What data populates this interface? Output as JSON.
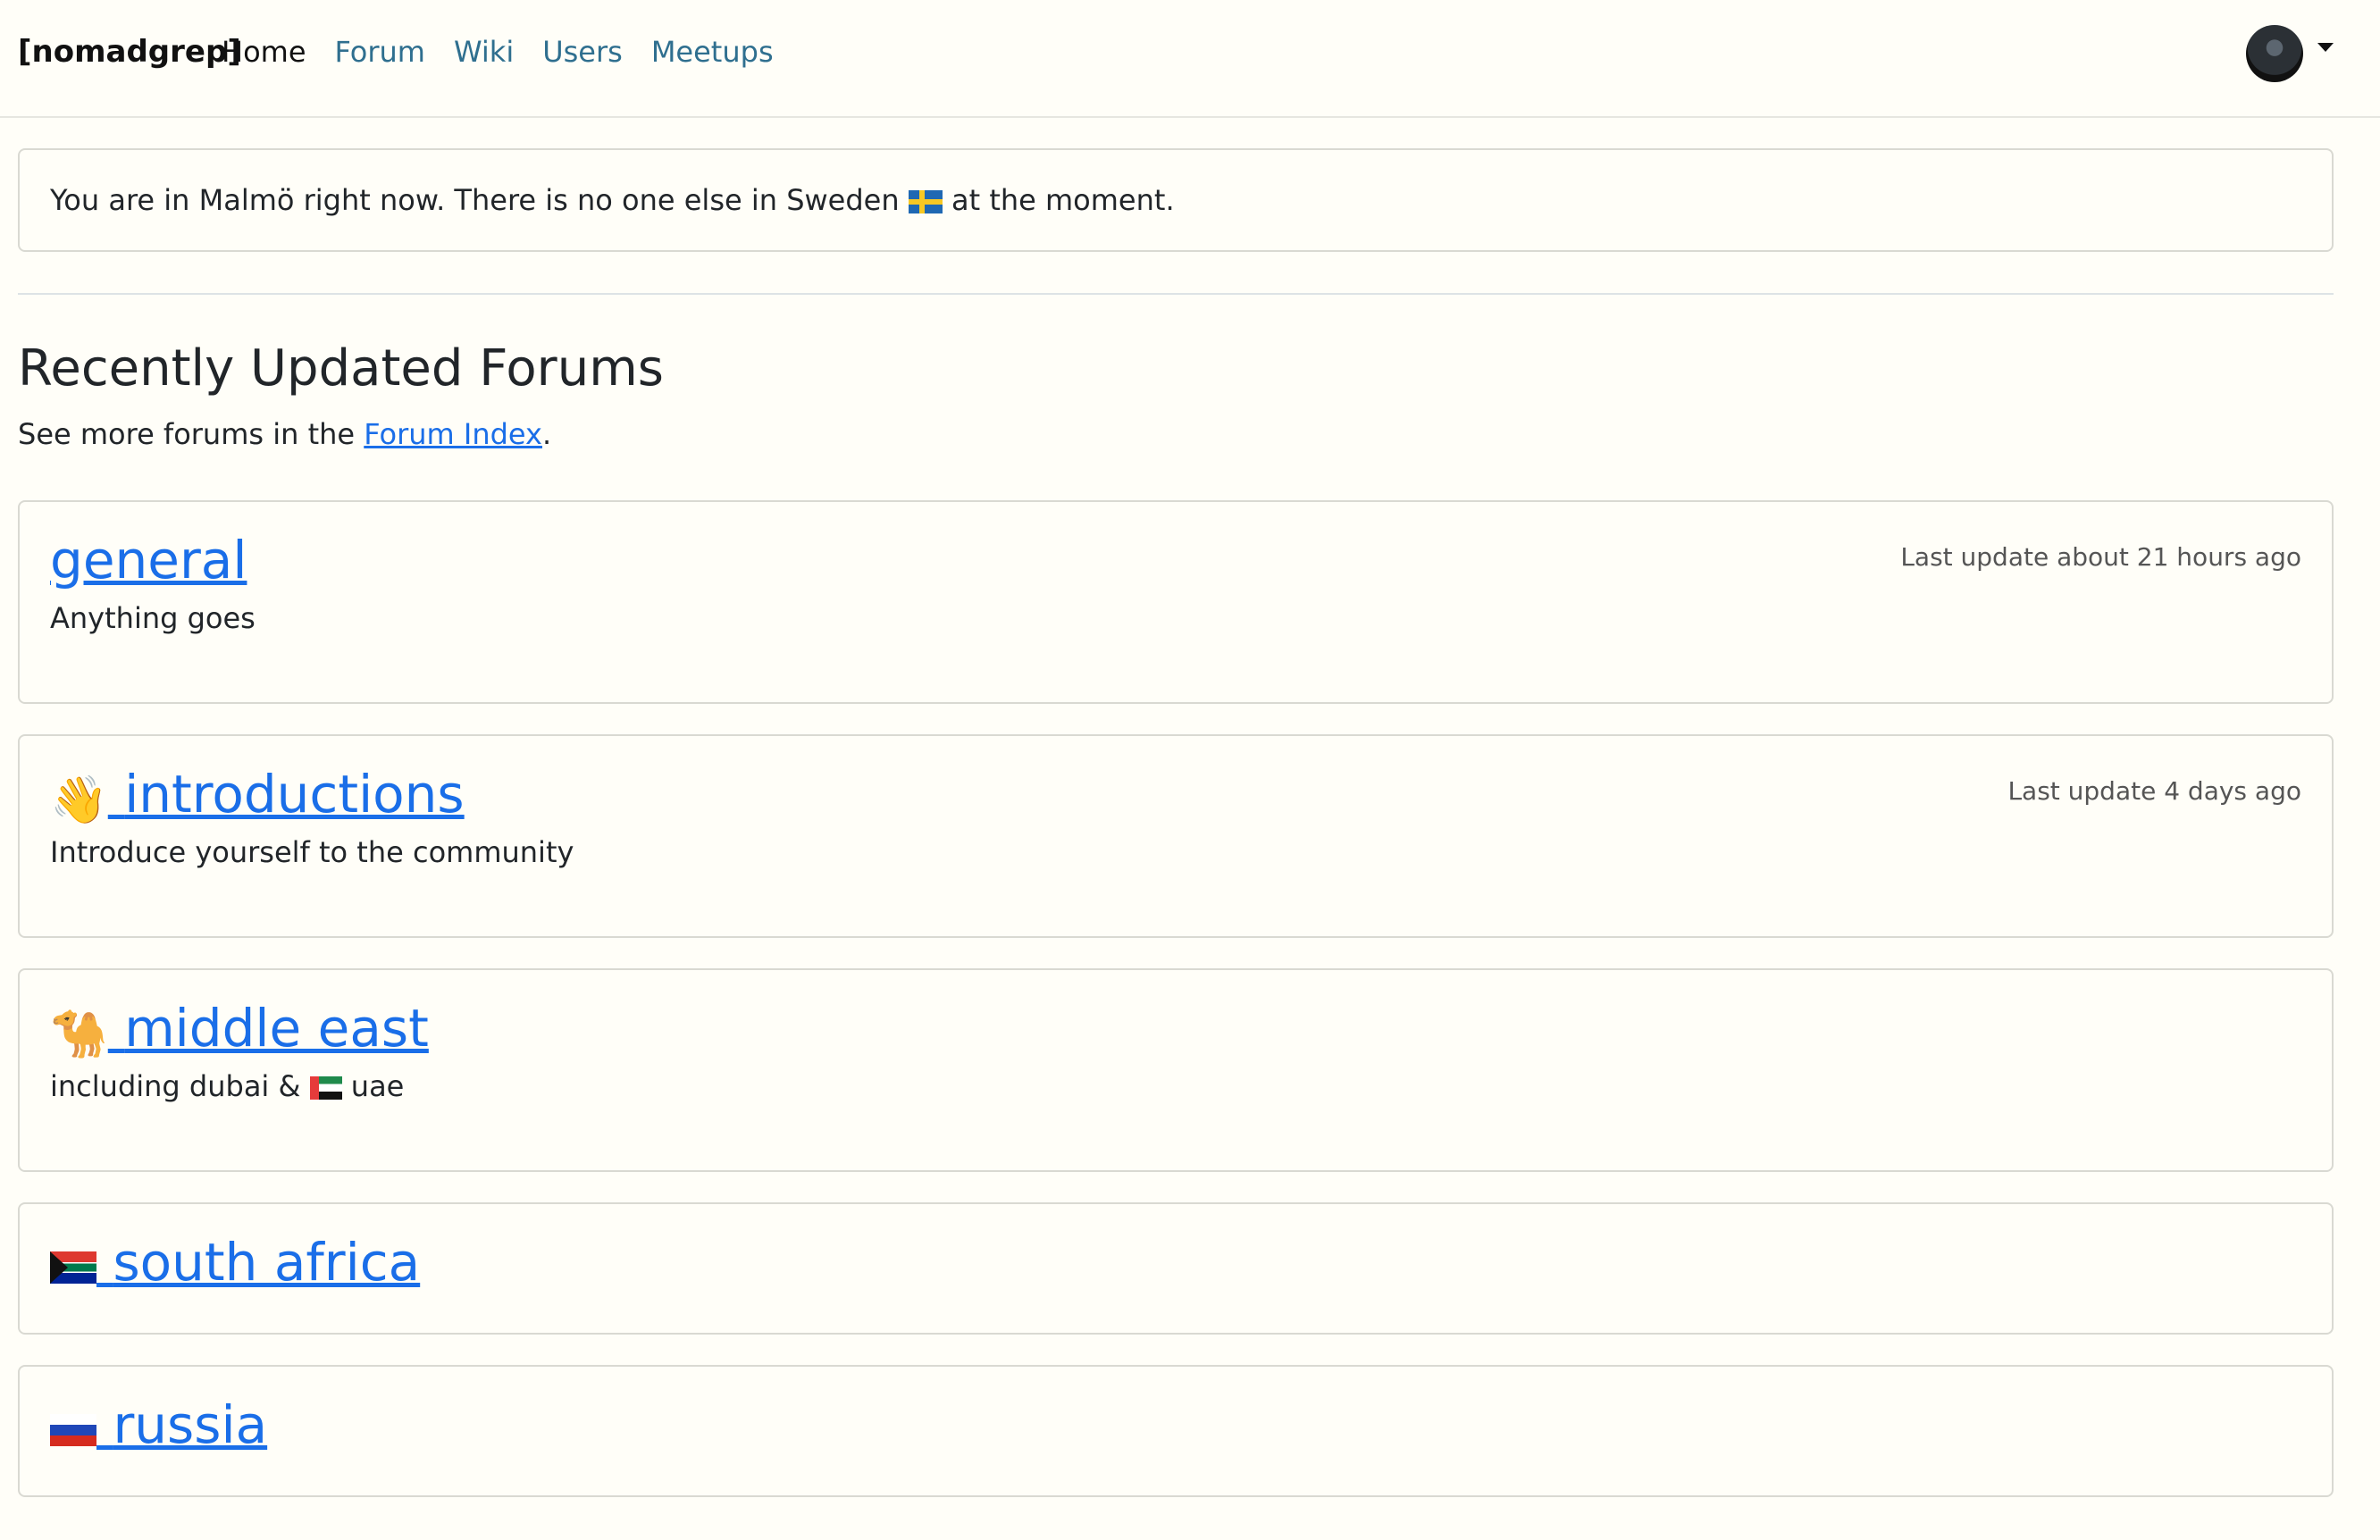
{
  "nav": {
    "brand": "[nomadgrep]",
    "links": [
      "Home",
      "Forum",
      "Wiki",
      "Users",
      "Meetups"
    ]
  },
  "location": {
    "text_before": "You are in Malmö right now. There is no one else in Sweden",
    "flag": "sweden-flag",
    "text_after": "at the moment."
  },
  "section": {
    "title": "Recently Updated Forums",
    "subtitle_before": "See more forums in the",
    "subtitle_link": "Forum Index",
    "subtitle_after": "."
  },
  "forums": [
    {
      "emoji": "",
      "title": "general",
      "description": "Anything goes",
      "last_update": "Last update about 21 hours ago"
    },
    {
      "emoji": "👋",
      "title": "introductions",
      "description": "Introduce yourself to the community",
      "last_update": "Last update 4 days ago"
    },
    {
      "emoji": "🐪",
      "title": "middle east",
      "description_before": "including dubai &",
      "description_flag": "uae-flag",
      "description_after": "uae"
    },
    {
      "emoji": "south-africa-flag",
      "title": "south africa"
    },
    {
      "emoji": "russia-flag",
      "title": "russia"
    }
  ],
  "colors": {
    "background": "#fffef8",
    "link": "#1a6ee8",
    "nav_link": "#2f6f8f",
    "border": "#d9d9d2"
  }
}
